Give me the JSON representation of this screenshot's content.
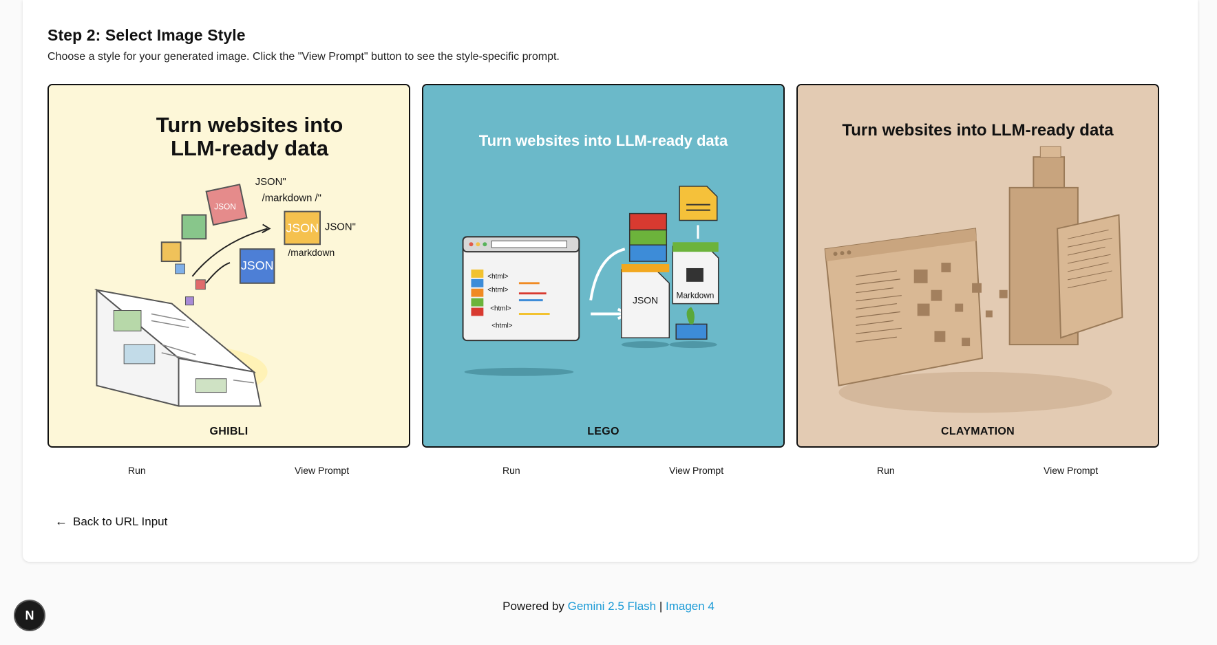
{
  "step": {
    "title": "Step 2: Select Image Style",
    "description": "Choose a style for your generated image. Click the \"View Prompt\" button to see the style-specific prompt."
  },
  "cards": [
    {
      "label": "GHIBLI",
      "image_title_line1": "Turn websites into",
      "image_title_line2": "LLM-ready data",
      "annotations": [
        "JSON\"",
        "/markdown /\"",
        "JSON\"",
        "/markdown",
        "JSON",
        "JSON",
        "JSON"
      ],
      "run_label": "Run",
      "view_prompt_label": "View Prompt",
      "background": "#fdf7d8"
    },
    {
      "label": "LEGO",
      "image_title": "Turn websites into LLM-ready data",
      "code_lines": [
        "<html>",
        "<html>",
        "<html>",
        "<html>"
      ],
      "doc_labels": [
        "JSON",
        "Markdown"
      ],
      "run_label": "Run",
      "view_prompt_label": "View Prompt",
      "background": "#6bb9c9"
    },
    {
      "label": "CLAYMATION",
      "image_title": "Turn websites into LLM-ready data",
      "run_label": "Run",
      "view_prompt_label": "View Prompt",
      "background": "#e3cbb3"
    }
  ],
  "back_link": {
    "label": "Back to URL Input",
    "icon": "arrow-left-icon"
  },
  "footer": {
    "prefix": "Powered by ",
    "link1": "Gemini 2.5 Flash",
    "separator": " | ",
    "link2": "Imagen 4",
    "link_color": "#1a9ad6"
  },
  "badge": {
    "letter": "N"
  }
}
